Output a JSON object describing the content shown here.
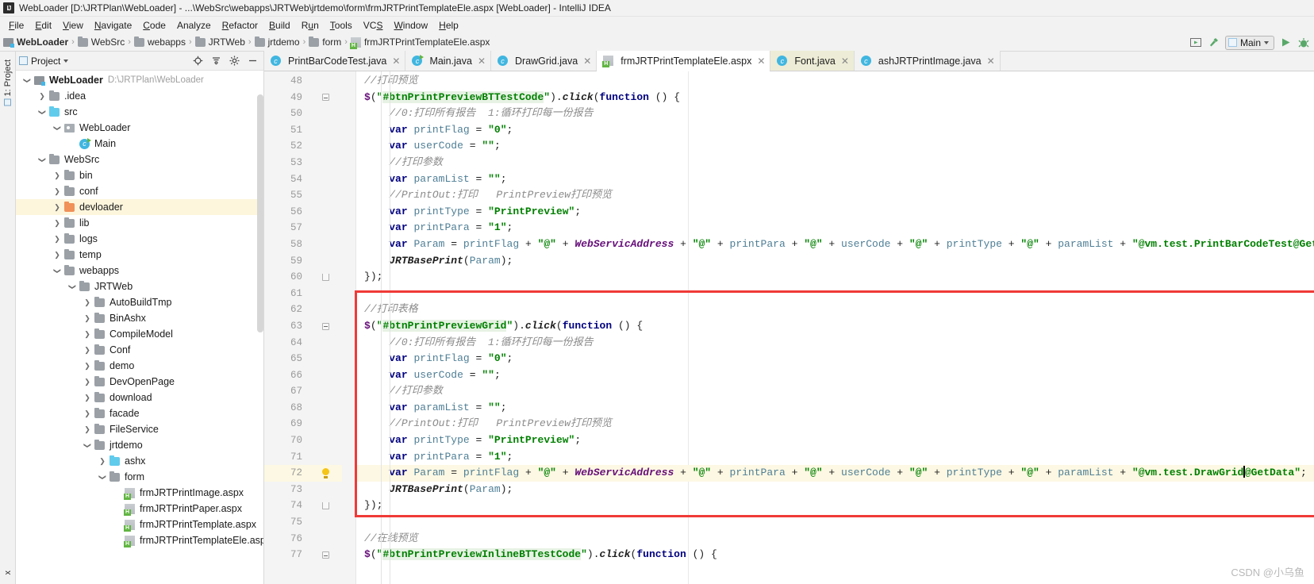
{
  "window": {
    "title": "WebLoader [D:\\JRTPlan\\WebLoader] - ...\\WebSrc\\webapps\\JRTWeb\\jrtdemo\\form\\frmJRTPrintTemplateEle.aspx [WebLoader] - IntelliJ IDEA",
    "logo": "IJ"
  },
  "menu": [
    "File",
    "Edit",
    "View",
    "Navigate",
    "Code",
    "Analyze",
    "Refactor",
    "Build",
    "Run",
    "Tools",
    "VCS",
    "Window",
    "Help"
  ],
  "breadcrumb": [
    {
      "label": "WebLoader",
      "icon": "module-icon",
      "bold": true
    },
    {
      "label": "WebSrc",
      "icon": "folder-icon",
      "bold": false
    },
    {
      "label": "webapps",
      "icon": "folder-icon",
      "bold": false
    },
    {
      "label": "JRTWeb",
      "icon": "folder-icon",
      "bold": false
    },
    {
      "label": "jrtdemo",
      "icon": "folder-icon",
      "bold": false
    },
    {
      "label": "form",
      "icon": "folder-icon",
      "bold": false
    },
    {
      "label": "frmJRTPrintTemplateEle.aspx",
      "icon": "aspx-file-icon",
      "bold": false
    }
  ],
  "toolbar_right": {
    "run_config_label": "Main",
    "icons": [
      "build-icon",
      "hammer-icon",
      "run-icon",
      "debug-icon"
    ]
  },
  "left_strip": {
    "project_tab": "1: Project",
    "bottom_tab": "x"
  },
  "project_panel": {
    "title": "Project",
    "actions": [
      "locate-icon",
      "collapse-all-icon",
      "gear-icon",
      "minimize-icon"
    ],
    "tree": [
      {
        "depth": 0,
        "arrow": "down",
        "icon": "module-icon",
        "label": "WebLoader",
        "bold": true,
        "path": "D:\\JRTPlan\\WebLoader"
      },
      {
        "depth": 1,
        "arrow": "right",
        "icon": "folder-icon",
        "label": ".idea"
      },
      {
        "depth": 1,
        "arrow": "down",
        "icon": "folder-blue-icon",
        "label": "src"
      },
      {
        "depth": 2,
        "arrow": "down",
        "icon": "package-icon",
        "label": "WebLoader"
      },
      {
        "depth": 3,
        "arrow": "none",
        "icon": "class-runnable-icon",
        "label": "Main"
      },
      {
        "depth": 1,
        "arrow": "down",
        "icon": "folder-icon",
        "label": "WebSrc"
      },
      {
        "depth": 2,
        "arrow": "right",
        "icon": "folder-icon",
        "label": "bin"
      },
      {
        "depth": 2,
        "arrow": "right",
        "icon": "folder-icon",
        "label": "conf"
      },
      {
        "depth": 2,
        "arrow": "right",
        "icon": "folder-orange-icon",
        "label": "devloader",
        "selected": true
      },
      {
        "depth": 2,
        "arrow": "right",
        "icon": "folder-icon",
        "label": "lib"
      },
      {
        "depth": 2,
        "arrow": "right",
        "icon": "folder-icon",
        "label": "logs"
      },
      {
        "depth": 2,
        "arrow": "right",
        "icon": "folder-icon",
        "label": "temp"
      },
      {
        "depth": 2,
        "arrow": "down",
        "icon": "folder-icon",
        "label": "webapps"
      },
      {
        "depth": 3,
        "arrow": "down",
        "icon": "folder-icon",
        "label": "JRTWeb"
      },
      {
        "depth": 4,
        "arrow": "right",
        "icon": "folder-icon",
        "label": "AutoBuildTmp"
      },
      {
        "depth": 4,
        "arrow": "right",
        "icon": "folder-icon",
        "label": "BinAshx"
      },
      {
        "depth": 4,
        "arrow": "right",
        "icon": "folder-icon",
        "label": "CompileModel"
      },
      {
        "depth": 4,
        "arrow": "right",
        "icon": "folder-icon",
        "label": "Conf"
      },
      {
        "depth": 4,
        "arrow": "right",
        "icon": "folder-icon",
        "label": "demo"
      },
      {
        "depth": 4,
        "arrow": "right",
        "icon": "folder-icon",
        "label": "DevOpenPage"
      },
      {
        "depth": 4,
        "arrow": "right",
        "icon": "folder-icon",
        "label": "download"
      },
      {
        "depth": 4,
        "arrow": "right",
        "icon": "folder-icon",
        "label": "facade"
      },
      {
        "depth": 4,
        "arrow": "right",
        "icon": "folder-icon",
        "label": "FileService"
      },
      {
        "depth": 4,
        "arrow": "down",
        "icon": "folder-icon",
        "label": "jrtdemo"
      },
      {
        "depth": 5,
        "arrow": "right",
        "icon": "folder-blue-icon",
        "label": "ashx"
      },
      {
        "depth": 5,
        "arrow": "down",
        "icon": "folder-icon",
        "label": "form"
      },
      {
        "depth": 6,
        "arrow": "none",
        "icon": "aspx-file-icon",
        "label": "frmJRTPrintImage.aspx"
      },
      {
        "depth": 6,
        "arrow": "none",
        "icon": "aspx-file-icon",
        "label": "frmJRTPrintPaper.aspx"
      },
      {
        "depth": 6,
        "arrow": "none",
        "icon": "aspx-file-icon",
        "label": "frmJRTPrintTemplate.aspx"
      },
      {
        "depth": 6,
        "arrow": "none",
        "icon": "aspx-file-icon",
        "label": "frmJRTPrintTemplateEle.aspx"
      }
    ]
  },
  "editor_tabs": [
    {
      "label": "PrintBarCodeTest.java",
      "icon": "java-class-icon",
      "active": false,
      "closable": true
    },
    {
      "label": "Main.java",
      "icon": "java-runnable-class-icon",
      "active": false,
      "closable": true
    },
    {
      "label": "DrawGrid.java",
      "icon": "java-class-icon",
      "active": false,
      "closable": true
    },
    {
      "label": "frmJRTPrintTemplateEle.aspx",
      "icon": "aspx-file-icon",
      "active": true,
      "closable": true
    },
    {
      "label": "Font.java",
      "icon": "java-class-icon",
      "active": false,
      "closable": true,
      "highlighted": true
    },
    {
      "label": "ashJRTPrintImage.java",
      "icon": "java-class-icon",
      "active": false,
      "closable": true
    }
  ],
  "editor": {
    "first_line": 48,
    "current_line": 72,
    "colors": {
      "keyword": "#000080",
      "string": "#008000",
      "comment": "#8c8c8c",
      "global_var": "#660e7a",
      "identifier": "#5c8ca8",
      "current_line_bg": "#fdf8e3",
      "annotation_box": "#f03a37",
      "selection_highlight": "#e7f2e4"
    },
    "lines": [
      {
        "n": 48,
        "indent": 0,
        "text": "//打印预览"
      },
      {
        "n": 49,
        "indent": 0,
        "text": "$(\"#btnPrintPreviewBTTestCode\").click(function () {",
        "fold": "minus"
      },
      {
        "n": 50,
        "indent": 0,
        "text": "    //0:打印所有报告  1:循环打印每一份报告"
      },
      {
        "n": 51,
        "indent": 0,
        "text": "    var printFlag = \"0\";"
      },
      {
        "n": 52,
        "indent": 0,
        "text": "    var userCode = \"\";"
      },
      {
        "n": 53,
        "indent": 0,
        "text": "    //打印参数"
      },
      {
        "n": 54,
        "indent": 0,
        "text": "    var paramList = \"\";"
      },
      {
        "n": 55,
        "indent": 0,
        "text": "    //PrintOut:打印   PrintPreview打印预览"
      },
      {
        "n": 56,
        "indent": 0,
        "text": "    var printType = \"PrintPreview\";"
      },
      {
        "n": 57,
        "indent": 0,
        "text": "    var printPara = \"1\";"
      },
      {
        "n": 58,
        "indent": 0,
        "text": "    var Param = printFlag + \"@\" + WebServicAddress + \"@\" + printPara + \"@\" + userCode + \"@\" + printType + \"@\" + paramList + \"@vm.test.PrintBarCodeTest@GetData\";"
      },
      {
        "n": 59,
        "indent": 0,
        "text": "    JRTBasePrint(Param);"
      },
      {
        "n": 60,
        "indent": 0,
        "text": "});",
        "fold": "end"
      },
      {
        "n": 61,
        "indent": 0,
        "text": ""
      },
      {
        "n": 62,
        "indent": 0,
        "text": "//打印表格"
      },
      {
        "n": 63,
        "indent": 0,
        "text": "$(\"#btnPrintPreviewGrid\").click(function () {",
        "fold": "minus"
      },
      {
        "n": 64,
        "indent": 0,
        "text": "    //0:打印所有报告  1:循环打印每一份报告"
      },
      {
        "n": 65,
        "indent": 0,
        "text": "    var printFlag = \"0\";"
      },
      {
        "n": 66,
        "indent": 0,
        "text": "    var userCode = \"\";"
      },
      {
        "n": 67,
        "indent": 0,
        "text": "    //打印参数"
      },
      {
        "n": 68,
        "indent": 0,
        "text": "    var paramList = \"\";"
      },
      {
        "n": 69,
        "indent": 0,
        "text": "    //PrintOut:打印   PrintPreview打印预览"
      },
      {
        "n": 70,
        "indent": 0,
        "text": "    var printType = \"PrintPreview\";"
      },
      {
        "n": 71,
        "indent": 0,
        "text": "    var printPara = \"1\";"
      },
      {
        "n": 72,
        "indent": 0,
        "text": "    var Param = printFlag + \"@\" + WebServicAddress + \"@\" + printPara + \"@\" + userCode + \"@\" + printType + \"@\" + paramList + \"@vm.test.DrawGrid@GetData\";",
        "current": true,
        "bulb": true
      },
      {
        "n": 73,
        "indent": 0,
        "text": "    JRTBasePrint(Param);"
      },
      {
        "n": 74,
        "indent": 0,
        "text": "});",
        "fold": "end"
      },
      {
        "n": 75,
        "indent": 0,
        "text": ""
      },
      {
        "n": 76,
        "indent": 0,
        "text": "//在线预览"
      },
      {
        "n": 77,
        "indent": 0,
        "text": "$(\"#btnPrintPreviewInlineBTTestCode\").click(function () {",
        "fold": "minus"
      }
    ]
  },
  "watermark": "CSDN @小乌鱼"
}
